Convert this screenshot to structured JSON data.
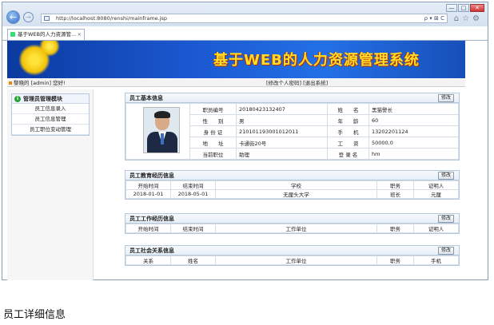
{
  "browser": {
    "url": "http://localhost:8080/renshi/mainframe.jsp",
    "address_tools": "ρ ▾ ⊠ C",
    "tab_title": "基于WEB的人力资源管...",
    "tab_close": "×",
    "window_controls": [
      "—",
      "□",
      "✕"
    ],
    "toolbar_icons": "⌂☆⚙"
  },
  "header": {
    "title": "基于WEB的人力资源管理系统"
  },
  "status": {
    "welcome": "黎晓的 [admin] 您好!",
    "links": "[修改个人密码] [退出系统]"
  },
  "sidebar": {
    "heading": "管理员管理模块",
    "items": [
      {
        "label": "员工信息录入"
      },
      {
        "label": "员工信息管理"
      },
      {
        "label": "员工职位变动管理"
      }
    ]
  },
  "basic_info": {
    "title": "员工基本信息",
    "edit_label": "修改",
    "rows": [
      {
        "l1": "职员编号",
        "v1": "20180423132407",
        "l2": "姓　　名",
        "v2": "黑猫警长"
      },
      {
        "l1": "性　　别",
        "v1": "男",
        "l2": "年　　龄",
        "v2": "60"
      },
      {
        "l1": "身 份 证",
        "v1": "210101193001012011",
        "l2": "手　　机",
        "v2": "13202201124"
      },
      {
        "l1": "地　　址",
        "v1": "卡通街20号",
        "l2": "工　　资",
        "v2": "50000.0"
      },
      {
        "l1": "当前职位",
        "v1": "助理",
        "l2": "登 录 名",
        "v2": "hm"
      }
    ]
  },
  "education": {
    "title": "员工教育经历信息",
    "edit_label": "修改",
    "headers": [
      "开始时间",
      "结束时间",
      "学校",
      "职务",
      "证明人"
    ],
    "rows": [
      [
        "2018-01-01",
        "2018-05-01",
        "无厘头大学",
        "班长",
        "元厘"
      ]
    ]
  },
  "work": {
    "title": "员工工作经历信息",
    "edit_label": "修改",
    "headers": [
      "开始时间",
      "结束时间",
      "工作单位",
      "职务",
      "证明人"
    ]
  },
  "social": {
    "title": "员工社会关系信息",
    "edit_label": "修改",
    "headers": [
      "关系",
      "姓名",
      "工作单位",
      "职务",
      "手机"
    ]
  },
  "caption": "员工详细信息"
}
